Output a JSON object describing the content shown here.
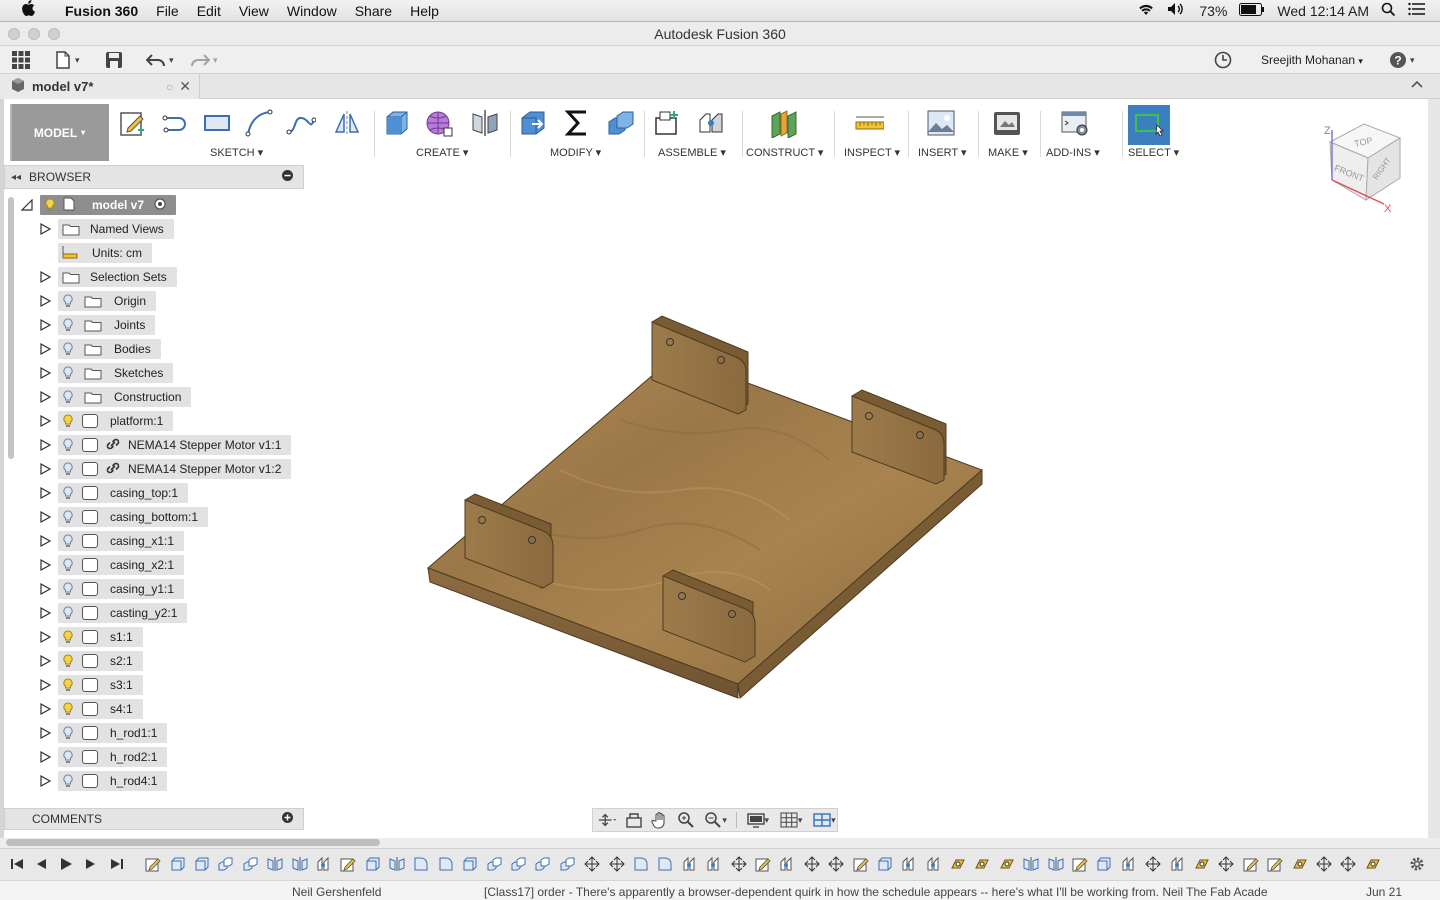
{
  "menubar": {
    "app_name": "Fusion 360",
    "menus": [
      "File",
      "Edit",
      "View",
      "Window",
      "Share",
      "Help"
    ],
    "battery": "73%",
    "clock": "Wed 12:14 AM"
  },
  "window": {
    "title": "Autodesk Fusion 360"
  },
  "quick_access": {
    "user_name": "Sreejith Mohanan"
  },
  "tab": {
    "name": "model v7*"
  },
  "toolbar": {
    "workspace": "MODEL",
    "groups": [
      "SKETCH",
      "CREATE",
      "MODIFY",
      "ASSEMBLE",
      "CONSTRUCT",
      "INSPECT",
      "INSERT",
      "MAKE",
      "ADD-INS",
      "SELECT"
    ]
  },
  "viewcube": {
    "top": "TOP",
    "front": "FRONT",
    "right": "RIGHT",
    "axis_x": "X",
    "axis_z": "Z"
  },
  "browser": {
    "title": "BROWSER",
    "root": "model v7",
    "items": [
      {
        "label": "Named Views"
      },
      {
        "label": "Units: cm"
      },
      {
        "label": "Selection Sets"
      },
      {
        "label": "Origin"
      },
      {
        "label": "Joints"
      },
      {
        "label": "Bodies"
      },
      {
        "label": "Sketches"
      },
      {
        "label": "Construction"
      },
      {
        "label": "platform:1"
      },
      {
        "label": "NEMA14 Stepper Motor v1:1"
      },
      {
        "label": "NEMA14 Stepper Motor v1:2"
      },
      {
        "label": "casing_top:1"
      },
      {
        "label": "casing_bottom:1"
      },
      {
        "label": "casing_x1:1"
      },
      {
        "label": "casing_x2:1"
      },
      {
        "label": "casing_y1:1"
      },
      {
        "label": "casting_y2:1"
      },
      {
        "label": "s1:1"
      },
      {
        "label": "s2:1"
      },
      {
        "label": "s3:1"
      },
      {
        "label": "s4:1"
      },
      {
        "label": "h_rod1:1"
      },
      {
        "label": "h_rod2:1"
      },
      {
        "label": "h_rod4:1"
      }
    ]
  },
  "comments": {
    "title": "COMMENTS"
  },
  "mail_strip": {
    "sender": "Neil Gershenfeld",
    "subject": "[Class17] order - There's apparently a browser-dependent quirk in how the schedule appears -- here's what I'll be working from. Neil The Fab Acade",
    "date": "Jun 21"
  },
  "colors": {
    "accent": "#3b7fbf",
    "wood": "#a07d4e",
    "panel": "#e4e4e4"
  }
}
